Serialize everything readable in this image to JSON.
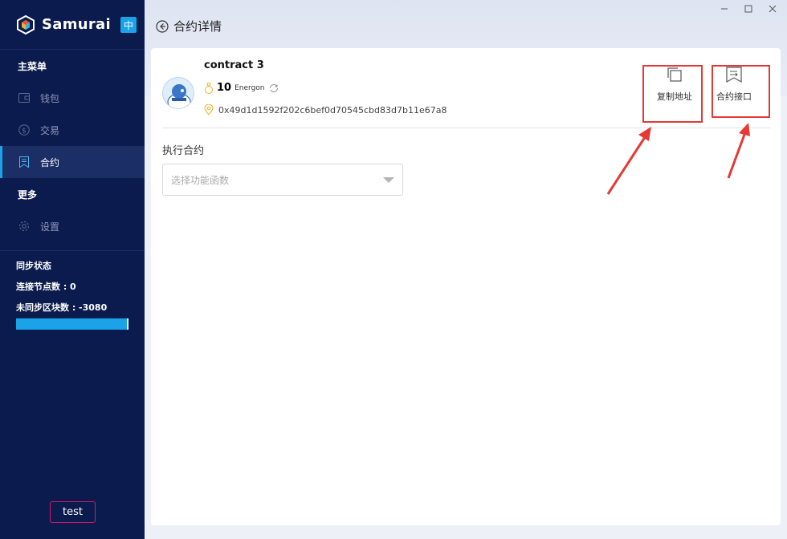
{
  "sidebar": {
    "brand": "Samurai",
    "lang": "中",
    "main_menu": "主菜单",
    "items": [
      {
        "label": "钱包",
        "icon": "wallet-icon"
      },
      {
        "label": "交易",
        "icon": "dollar-icon"
      },
      {
        "label": "合约",
        "icon": "contract-icon",
        "active": true
      }
    ],
    "more": "更多",
    "settings": "设置",
    "sync_status": "同步状态",
    "connected_nodes": "连接节点数 : 0",
    "unsynced_blocks": "未同步区块数 : -3080",
    "sync_progress": 1.0,
    "user": "test"
  },
  "header": {
    "back_label": "合约详情",
    "window_controls": [
      "minimize-icon",
      "maximize-icon",
      "close-icon"
    ]
  },
  "contract": {
    "name": "contract 3",
    "energon_value": "10",
    "energon_unit": "Energon",
    "address": "0x49d1d1592f202c6bef0d70545cbd83d7b11e67a8",
    "copy_address": "复制地址",
    "contract_interface": "合约接口",
    "execute_label": "执行合约",
    "select_placeholder": "选择功能函数"
  },
  "colors": {
    "sidebar_bg": "#0b1b4d",
    "accent": "#1aa3e8",
    "annotation": "#e53935"
  }
}
